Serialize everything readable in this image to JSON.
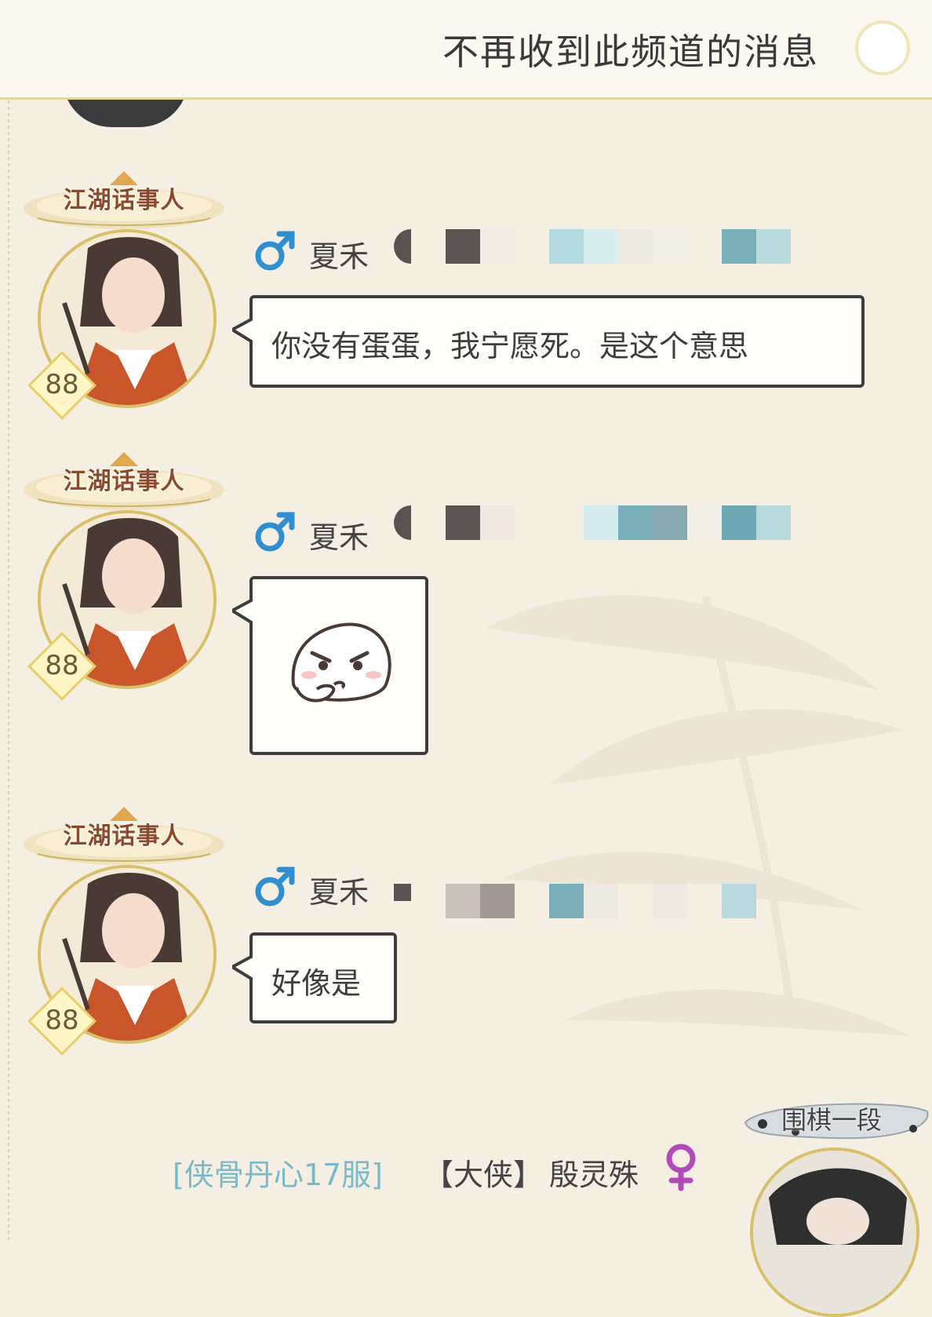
{
  "topbar": {
    "mute_label": "不再收到此频道的消息",
    "toggle_state": "off"
  },
  "messages": [
    {
      "title_badge": "江湖话事人",
      "level": "88",
      "gender": "male",
      "sender_name": "夏禾",
      "type": "text",
      "text": "你没有蛋蛋，我宁愿死。是这个意思"
    },
    {
      "title_badge": "江湖话事人",
      "level": "88",
      "gender": "male",
      "sender_name": "夏禾",
      "type": "sticker",
      "sticker": "thinking-face-sticker"
    },
    {
      "title_badge": "江湖话事人",
      "level": "88",
      "gender": "male",
      "sender_name": "夏禾",
      "type": "text",
      "text": "好像是"
    }
  ],
  "next_message": {
    "server": "[侠骨丹心17服]",
    "rank": "【大侠】",
    "sender_name": "殷灵殊",
    "gender": "female",
    "title_badge": "围棋一段"
  },
  "colors": {
    "background": "#f5eee2",
    "bubble_border": "#3d3d3d",
    "male": "#2f8fd0",
    "female": "#b24bb8",
    "server": "#7ab9c9"
  }
}
